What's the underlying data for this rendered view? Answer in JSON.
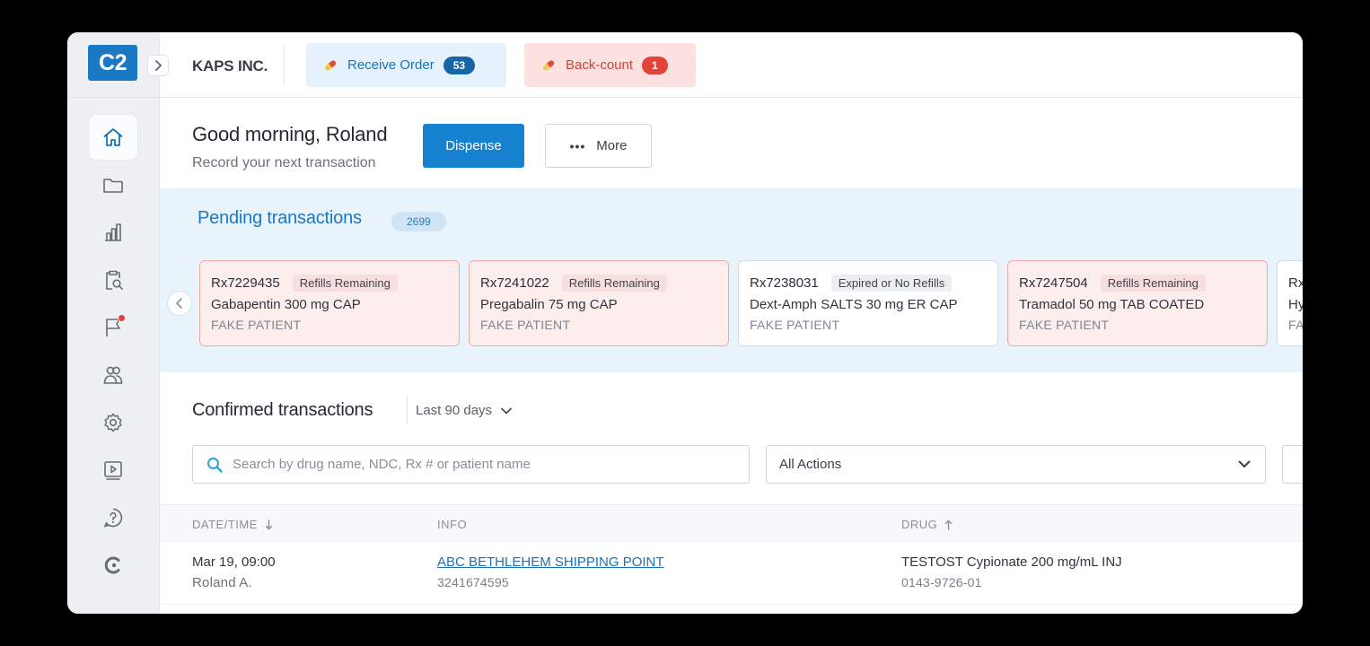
{
  "app": {
    "logo_text": "C2"
  },
  "sidebar": {
    "items": [
      {
        "name": "home",
        "icon": "home-icon",
        "active": true
      },
      {
        "name": "folder",
        "icon": "folder-icon",
        "active": false
      },
      {
        "name": "reports",
        "icon": "bar-chart-icon",
        "active": false
      },
      {
        "name": "audit",
        "icon": "clipboard-search-icon",
        "active": false
      },
      {
        "name": "flags",
        "icon": "flag-icon",
        "active": false,
        "notification": true
      },
      {
        "name": "users",
        "icon": "users-icon",
        "active": false
      },
      {
        "name": "settings",
        "icon": "gear-icon",
        "active": false
      },
      {
        "name": "tutorials",
        "icon": "video-icon",
        "active": false
      },
      {
        "name": "help",
        "icon": "help-icon",
        "active": false
      },
      {
        "name": "brand",
        "icon": "c-logo-icon",
        "active": false
      }
    ]
  },
  "topbar": {
    "company": "KAPS INC.",
    "receive_order": {
      "label": "Receive Order",
      "count": "53"
    },
    "back_count": {
      "label": "Back-count",
      "count": "1"
    }
  },
  "greeting": {
    "title": "Good morning, Roland",
    "subtitle": "Record your next transaction",
    "dispense_label": "Dispense",
    "more_label": "More"
  },
  "pending": {
    "title": "Pending transactions",
    "count": "2699",
    "cards": [
      {
        "rx": "Rx7229435",
        "tag": "Refills Remaining",
        "drug": "Gabapentin 300 mg CAP",
        "patient": "FAKE PATIENT",
        "status": "warn"
      },
      {
        "rx": "Rx7241022",
        "tag": "Refills Remaining",
        "drug": "Pregabalin 75 mg CAP",
        "patient": "FAKE PATIENT",
        "status": "warn"
      },
      {
        "rx": "Rx7238031",
        "tag": "Expired or No Refills",
        "drug": "Dext-Amph SALTS 30 mg ER CAP",
        "patient": "FAKE PATIENT",
        "status": "neutral"
      },
      {
        "rx": "Rx7247504",
        "tag": "Refills Remaining",
        "drug": "Tramadol 50 mg TAB COATED",
        "patient": "FAKE PATIENT",
        "status": "warn"
      },
      {
        "rx": "Rx",
        "tag": "",
        "drug": "Hy",
        "patient": "FA",
        "status": "neutral"
      }
    ]
  },
  "confirmed": {
    "title": "Confirmed transactions",
    "range": "Last 90 days",
    "search_placeholder": "Search by drug name, NDC, Rx # or patient name",
    "actions_select": "All Actions",
    "columns": {
      "date": "DATE/TIME",
      "info": "INFO",
      "drug": "DRUG"
    },
    "rows": [
      {
        "date": "Mar 19, 09:00",
        "user": "Roland A.",
        "info": "ABC BETHLEHEM SHIPPING POINT",
        "info_sub": "3241674595",
        "drug": "TESTOST Cypionate 200 mg/mL INJ",
        "ndc": "0143-9726-01"
      }
    ]
  },
  "colors": {
    "accent": "#1682cf",
    "warn_bg": "#fdeeee",
    "warn_border": "#f1a9a6",
    "pending_bg": "#e9f3fc"
  }
}
